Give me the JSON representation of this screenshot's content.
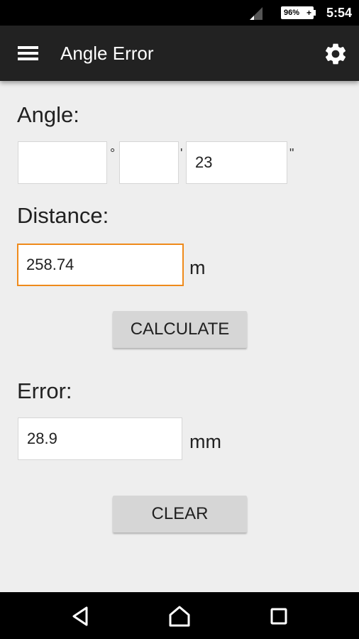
{
  "status_bar": {
    "battery_percent": "96%",
    "battery_charging_symbol": "+",
    "time": "5:54"
  },
  "app_bar": {
    "title": "Angle Error",
    "menu_icon": "hamburger-menu-icon",
    "settings_icon": "gear-icon"
  },
  "angle": {
    "label": "Angle:",
    "degrees": {
      "value": "",
      "unit": "°"
    },
    "minutes": {
      "value": "",
      "unit": "'"
    },
    "seconds": {
      "value": "23",
      "unit": "\""
    }
  },
  "distance": {
    "label": "Distance:",
    "value": "258.74",
    "unit": "m"
  },
  "calculate_button": "CALCULATE",
  "error": {
    "label": "Error:",
    "value": "28.9",
    "unit": "mm"
  },
  "clear_button": "CLEAR",
  "nav_bar": {
    "back_icon": "back-triangle-icon",
    "home_icon": "home-icon",
    "recents_icon": "recents-square-icon"
  },
  "colors": {
    "app_bar": "#222222",
    "background": "#eeeeee",
    "focus_accent": "#ef8a1b",
    "button": "#d6d6d6"
  }
}
